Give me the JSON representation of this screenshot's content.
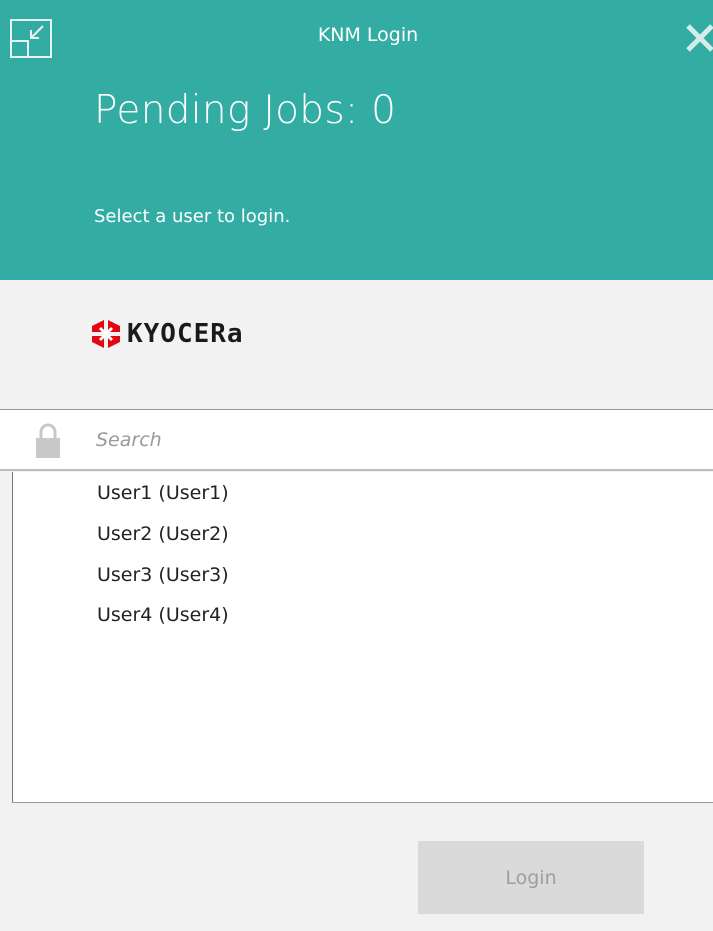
{
  "window": {
    "title": "KNM Login"
  },
  "header": {
    "pending_jobs": "Pending Jobs: 0",
    "instruction": "Select a user to login.",
    "background_color": "#33ada3"
  },
  "logo": {
    "text": "KYOCERa",
    "mark_color": "#e30613"
  },
  "search": {
    "placeholder": "Search",
    "value": ""
  },
  "users": [
    {
      "label": "User1 (User1)"
    },
    {
      "label": "User2 (User2)"
    },
    {
      "label": "User3 (User3)"
    },
    {
      "label": "User4 (User4)"
    }
  ],
  "footer": {
    "login_label": "Login",
    "login_enabled": false
  },
  "icons": {
    "restore": "restore-icon",
    "close": "close-icon",
    "lock": "lock-icon"
  }
}
